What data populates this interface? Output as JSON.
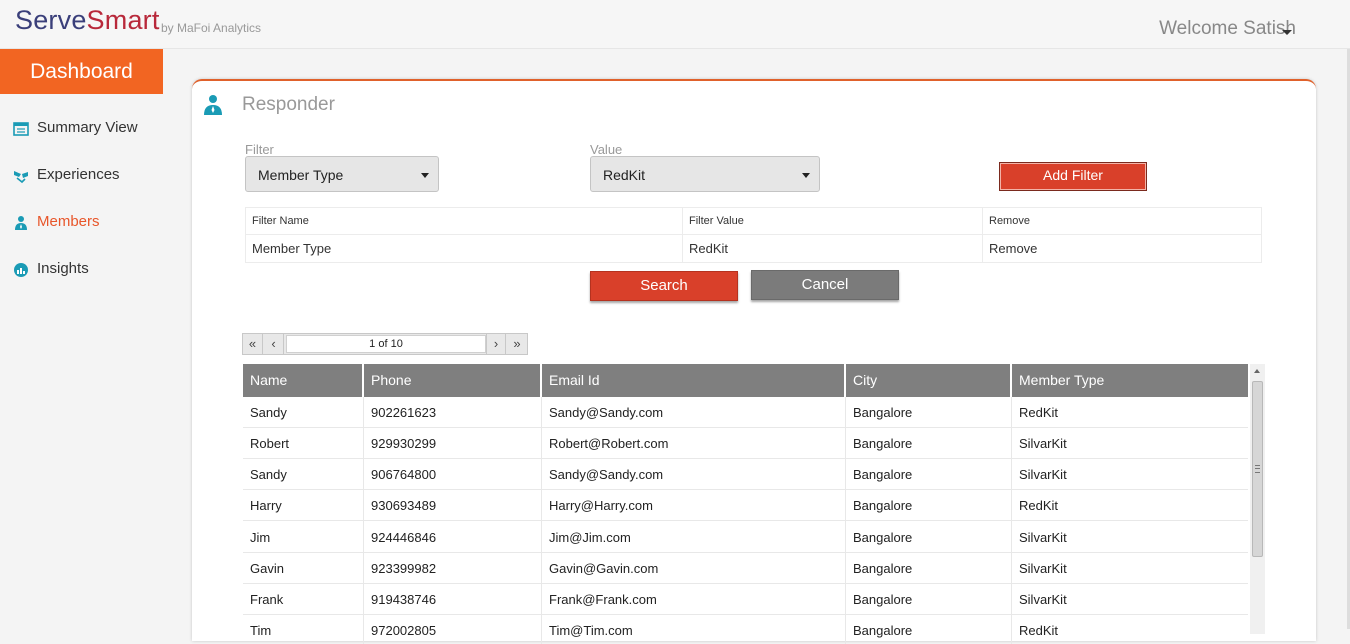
{
  "header": {
    "brand_serve": "Serve",
    "brand_smart": "Smart",
    "brand_sub": "by MaFoi Analytics",
    "welcome": "Welcome Satish"
  },
  "sidebar": {
    "dashboard_label": "Dashboard",
    "items": [
      {
        "label": "Summary View",
        "icon": "summary-icon"
      },
      {
        "label": "Experiences",
        "icon": "experiences-icon"
      },
      {
        "label": "Members",
        "icon": "members-icon",
        "active": true
      },
      {
        "label": "Insights",
        "icon": "insights-icon"
      }
    ]
  },
  "panel": {
    "title": "Responder",
    "filter_label": "Filter",
    "filter_value": "Member Type",
    "value_label": "Value",
    "value_value": "RedKit",
    "add_filter_label": "Add Filter",
    "filter_table": {
      "headers": [
        "Filter Name",
        "Filter Value",
        "Remove"
      ],
      "row": [
        "Member Type",
        "RedKit",
        "Remove"
      ]
    },
    "search_label": "Search",
    "cancel_label": "Cancel",
    "pager": {
      "first": "«",
      "prev": "‹",
      "page_text": "1 of 10",
      "next": "›",
      "last": "»"
    },
    "grid": {
      "headers": [
        "Name",
        "Phone",
        "Email Id",
        "City",
        "Member Type"
      ],
      "rows": [
        [
          "Sandy",
          "902261623",
          "Sandy@Sandy.com",
          "Bangalore",
          "RedKit"
        ],
        [
          "Robert",
          "929930299",
          "Robert@Robert.com",
          "Bangalore",
          "SilvarKit"
        ],
        [
          "Sandy",
          "906764800",
          "Sandy@Sandy.com",
          "Bangalore",
          "SilvarKit"
        ],
        [
          "Harry",
          "930693489",
          "Harry@Harry.com",
          "Bangalore",
          "RedKit"
        ],
        [
          "Jim",
          "924446846",
          "Jim@Jim.com",
          "Bangalore",
          "SilvarKit"
        ],
        [
          "Gavin",
          "923399982",
          "Gavin@Gavin.com",
          "Bangalore",
          "SilvarKit"
        ],
        [
          "Frank",
          "919438746",
          "Frank@Frank.com",
          "Bangalore",
          "SilvarKit"
        ],
        [
          "Tim",
          "972002805",
          "Tim@Tim.com",
          "Bangalore",
          "RedKit"
        ]
      ]
    }
  },
  "colors": {
    "accent": "#f26522",
    "button_red": "#d9402a",
    "button_gray": "#7b7b7b",
    "icon_teal": "#1a9bb5"
  }
}
